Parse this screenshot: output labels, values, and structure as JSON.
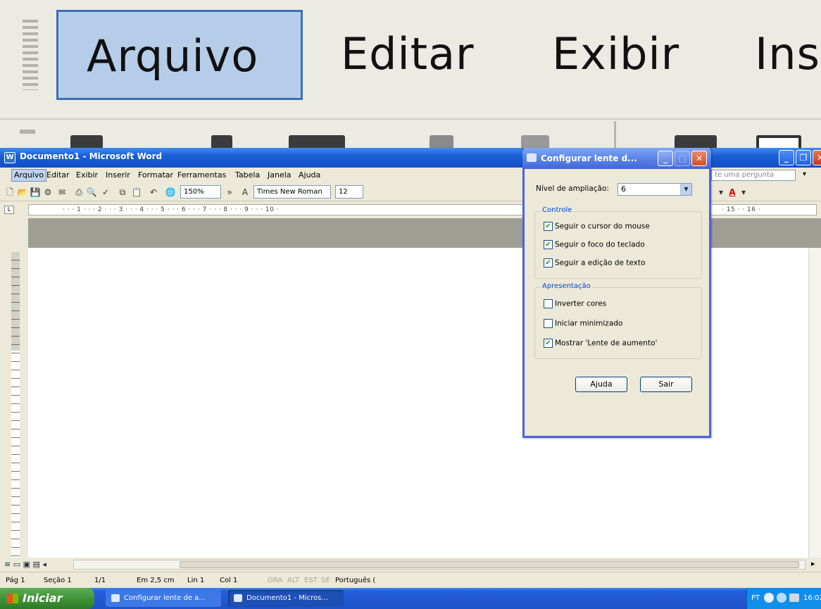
{
  "lens": {
    "menu": [
      {
        "label": "Arquivo",
        "active": true
      },
      {
        "label": "Editar",
        "active": false
      },
      {
        "label": "Exibir",
        "active": false
      },
      {
        "label": "Ins",
        "active": false
      }
    ]
  },
  "window": {
    "title": "Documento1 - Microsoft Word",
    "menu": [
      "Arquivo",
      "Editar",
      "Exibir",
      "Inserir",
      "Formatar",
      "Ferramentas",
      "Tabela",
      "Janela",
      "Ajuda"
    ],
    "ask_placeholder": "te uma pergunta"
  },
  "toolbar": {
    "zoom": "150%",
    "font": "Times New Roman",
    "size": "12"
  },
  "ruler": {
    "ticks": "· · · 1 · · · 2 · · · 3 · · · 4 · · · 5 · · · 6 · · · 7 · · · 8 · · · 9 · · · 10 ·",
    "right_ticks": "· 15 · · 16 ·"
  },
  "dialog": {
    "title": "Configurar lente d...",
    "zoom_label": "Nível de ampliação:",
    "zoom_value": "6",
    "group_control": {
      "label": "Controle",
      "options": [
        {
          "label": "Seguir o cursor do mouse",
          "checked": true
        },
        {
          "label": "Seguir o foco do teclado",
          "checked": true
        },
        {
          "label": "Seguir a edição de texto",
          "checked": true
        }
      ]
    },
    "group_presentation": {
      "label": "Apresentação",
      "options": [
        {
          "label": "Inverter cores",
          "checked": false
        },
        {
          "label": "Iniciar minimizado",
          "checked": false
        },
        {
          "label": "Mostrar 'Lente de aumento'",
          "checked": true
        }
      ]
    },
    "help_button": "Ajuda",
    "exit_button": "Sair"
  },
  "status": {
    "page": "Pág 1",
    "section": "Seção 1",
    "pages": "1/1",
    "at": "Em 2,5 cm",
    "line": "Lin 1",
    "col": "Col 1",
    "gra": "GRA",
    "alt": "ALT",
    "est": "EST",
    "se": "SE",
    "lang": "Português ("
  },
  "taskbar": {
    "start": "Iniciar",
    "tasks": [
      "Configurar lente de a...",
      "Documento1 - Micros..."
    ],
    "lang": "PT",
    "clock": "16:02"
  },
  "colors": {
    "xp_blue": "#0f4fc9",
    "start_green": "#3c8f34",
    "dialog_border": "#4c66d6"
  }
}
